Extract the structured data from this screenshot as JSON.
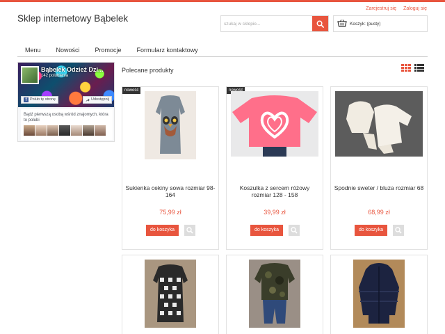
{
  "header": {
    "shop_title": "Sklep internetowy Bąbelek",
    "register_label": "Zarejestruj się",
    "login_label": "Zaloguj się",
    "search_placeholder": "szukaj w sklepie...",
    "cart_label": "Koszyk: (pusty)"
  },
  "nav": {
    "items": [
      "Menu",
      "Nowości",
      "Promocje",
      "Formularz kontaktowy"
    ]
  },
  "facebook": {
    "page_name": "Bąbelek Odzież Dzi...",
    "likes": "142 polubienia",
    "like_label": "Polub tę stronę",
    "share_label": "Udostępnij",
    "friends_text": "Bądź pierwszą osobą wśród znajomych, która to polubi"
  },
  "section": {
    "title": "Polecane produkty"
  },
  "products": [
    {
      "badge": "nowość",
      "name": "Sukienka cekiny sowa rozmiar 98- 164",
      "price": "75,99 zł",
      "add_label": "do koszyka"
    },
    {
      "badge": "nowość",
      "name": "Koszulka z sercem różowy rozmiar 128 - 158",
      "price": "39,99 zł",
      "add_label": "do koszyka"
    },
    {
      "badge": "",
      "name": "Spodnie sweter / bluza rozmiar 68",
      "price": "68,99 zł",
      "add_label": "do koszyka"
    },
    {
      "badge": "",
      "name": "",
      "price": "",
      "add_label": ""
    },
    {
      "badge": "",
      "name": "",
      "price": "",
      "add_label": ""
    },
    {
      "badge": "",
      "name": "",
      "price": "",
      "add_label": ""
    }
  ],
  "colors": {
    "accent": "#e8553e",
    "facebook_blue": "#3b5998"
  },
  "icons": {
    "search": "search-icon",
    "cart": "basket-icon",
    "grid_view": "grid-view-icon",
    "list_view": "list-view-icon",
    "zoom": "magnifier-icon"
  }
}
